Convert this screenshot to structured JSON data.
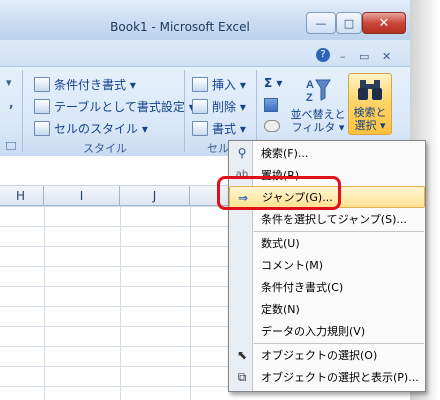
{
  "window": {
    "title": "Book1 - Microsoft Excel",
    "min_label": "—",
    "max_label": "□",
    "close_label": "✕"
  },
  "subbar": {
    "help_label": "?",
    "min_label": "–",
    "restore_label": "▭",
    "close_label": "✕"
  },
  "ribbon": {
    "left_edge_dropdown": "▾",
    "left_edge_comma": ",",
    "styles_group": {
      "conditional_format": "条件付き書式 ▾",
      "table_format": "テーブルとして書式設定 ▾",
      "cell_styles": "セルのスタイル ▾",
      "label": "スタイル"
    },
    "cells_group": {
      "insert": "挿入 ▾",
      "delete": "削除 ▾",
      "format": "書式 ▾",
      "label": "セル"
    },
    "editing_group": {
      "sum": "Σ ▾",
      "sort_filter_line1": "並べ替えと",
      "sort_filter_line2": "フィルタ ▾",
      "find_line1": "検索と",
      "find_line2": "選択 ▾"
    }
  },
  "columns": [
    "H",
    "I",
    "J"
  ],
  "menu": {
    "items": [
      {
        "label": "検索(F)...",
        "icon": "binoculars-icon"
      },
      {
        "label": "置換(R)...",
        "icon": "replace-icon"
      },
      {
        "label": "ジャンプ(G)...",
        "icon": "arrow-right-icon",
        "highlighted": true
      },
      {
        "label": "条件を選択してジャンプ(S)...",
        "icon": ""
      },
      {
        "label": "数式(U)",
        "icon": ""
      },
      {
        "label": "コメント(M)",
        "icon": ""
      },
      {
        "label": "条件付き書式(C)",
        "icon": ""
      },
      {
        "label": "定数(N)",
        "icon": ""
      },
      {
        "label": "データの入力規則(V)",
        "icon": ""
      },
      {
        "label": "オブジェクトの選択(O)",
        "icon": "pointer-icon"
      },
      {
        "label": "オブジェクトの選択と表示(P)...",
        "icon": "selection-pane-icon"
      }
    ]
  },
  "colors": {
    "highlight": "#ffe192",
    "annotation_box": "#e0101a",
    "ribbon_text": "#15428b"
  }
}
